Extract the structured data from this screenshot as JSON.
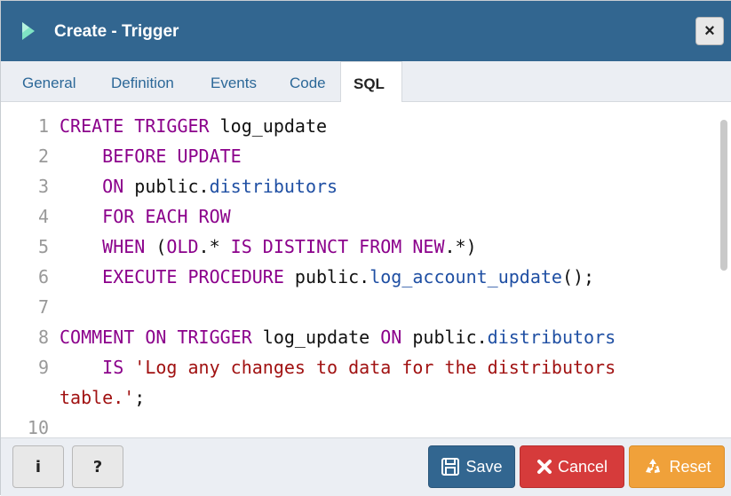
{
  "dialog": {
    "title": "Create - Trigger",
    "close_icon": "×"
  },
  "tabs": [
    {
      "label": "General"
    },
    {
      "label": "Definition"
    },
    {
      "label": "Events"
    },
    {
      "label": "Code"
    },
    {
      "label": "SQL"
    }
  ],
  "editor": {
    "lines": [
      {
        "num": "1",
        "segments": [
          [
            "kw",
            "CREATE TRIGGER "
          ],
          [
            "id",
            "log_update"
          ]
        ]
      },
      {
        "num": "2",
        "segments": [
          [
            "kw",
            "    BEFORE UPDATE"
          ]
        ]
      },
      {
        "num": "3",
        "segments": [
          [
            "kw",
            "    ON "
          ],
          [
            "id",
            "public"
          ],
          [
            "pun",
            "."
          ],
          [
            "var",
            "distributors"
          ]
        ]
      },
      {
        "num": "4",
        "segments": [
          [
            "kw",
            "    FOR EACH ROW"
          ]
        ]
      },
      {
        "num": "5",
        "segments": [
          [
            "kw",
            "    WHEN "
          ],
          [
            "pun",
            "("
          ],
          [
            "kw",
            "OLD"
          ],
          [
            "pun",
            ".* "
          ],
          [
            "kw",
            "IS DISTINCT FROM NEW"
          ],
          [
            "pun",
            ".*)"
          ]
        ]
      },
      {
        "num": "6",
        "segments": [
          [
            "kw",
            "    EXECUTE PROCEDURE "
          ],
          [
            "id",
            "public"
          ],
          [
            "pun",
            "."
          ],
          [
            "var",
            "log_account_update"
          ],
          [
            "pun",
            "();"
          ]
        ]
      },
      {
        "num": "7",
        "segments": []
      },
      {
        "num": "8",
        "segments": [
          [
            "kw",
            "COMMENT ON TRIGGER "
          ],
          [
            "id",
            "log_update "
          ],
          [
            "kw",
            "ON "
          ],
          [
            "id",
            "public"
          ],
          [
            "pun",
            "."
          ],
          [
            "var",
            "distributors"
          ]
        ]
      },
      {
        "num": "9",
        "segments": [
          [
            "kw",
            "    IS "
          ],
          [
            "str",
            "'Log any changes to data for the distributors"
          ]
        ]
      },
      {
        "num": "",
        "segments": [
          [
            "str",
            "table.'"
          ],
          [
            "pun",
            ";"
          ]
        ]
      },
      {
        "num": "10",
        "segments": []
      }
    ]
  },
  "footer": {
    "info_label": "i",
    "help_label": "?",
    "save_label": "Save",
    "cancel_label": "Cancel",
    "reset_label": "Reset"
  },
  "colors": {
    "titlebar": "#326690",
    "save": "#326690",
    "cancel": "#d63b3b",
    "reset": "#f0a13a"
  }
}
